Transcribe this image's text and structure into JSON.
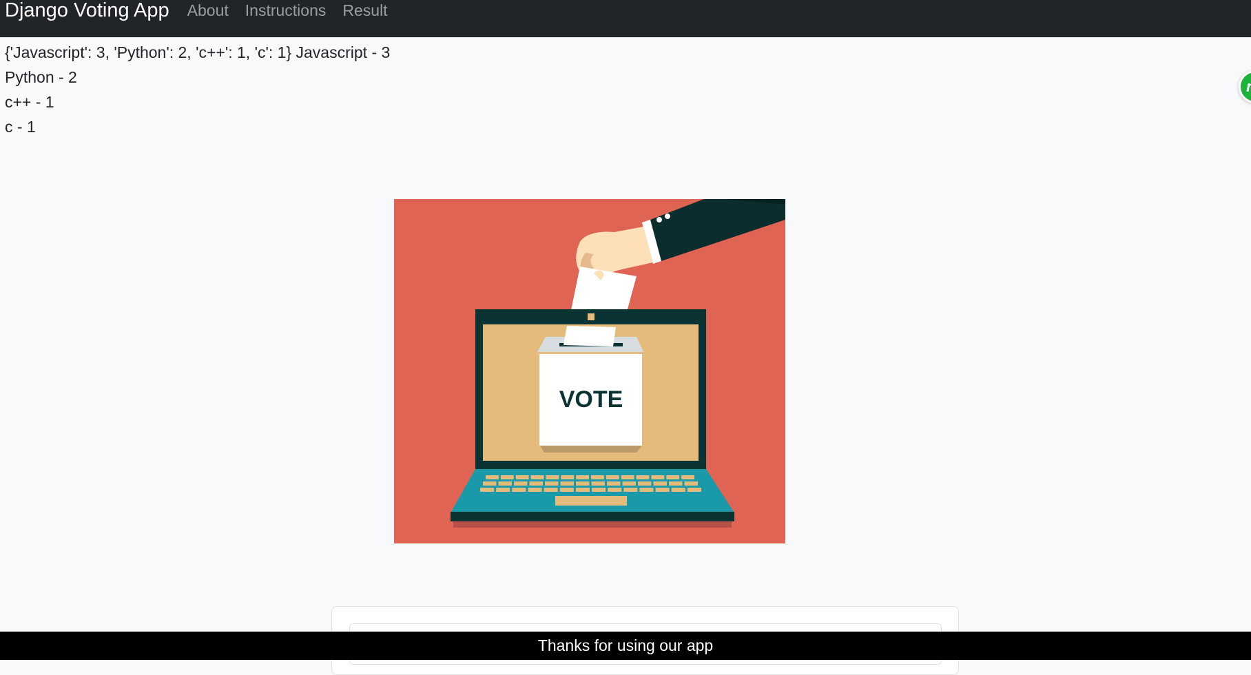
{
  "navbar": {
    "brand": "Django Voting App",
    "links": [
      "About",
      "Instructions",
      "Result"
    ]
  },
  "results": {
    "raw": "{'Javascript': 3, 'Python': 2, 'c++': 1, 'c': 1}",
    "lines": [
      "Javascript - 3",
      "Python - 2",
      "c++ - 1",
      "c - 1"
    ]
  },
  "image": {
    "ballot_text": "VOTE",
    "colors": {
      "background": "#e06453",
      "laptop_dark": "#0c3333",
      "screen": "#e4bb7a",
      "keyboard": "#1a9aa8",
      "sleeve": "#0b2d2d",
      "skin": "#fde0b8"
    }
  },
  "float_badge": {
    "glyph": "n"
  },
  "footer": {
    "text": "Thanks for using our app"
  },
  "colors": {
    "navbar": "#212529",
    "page_bg": "#f8f9fa",
    "footer": "#000000",
    "badge": "#1bb33a"
  }
}
